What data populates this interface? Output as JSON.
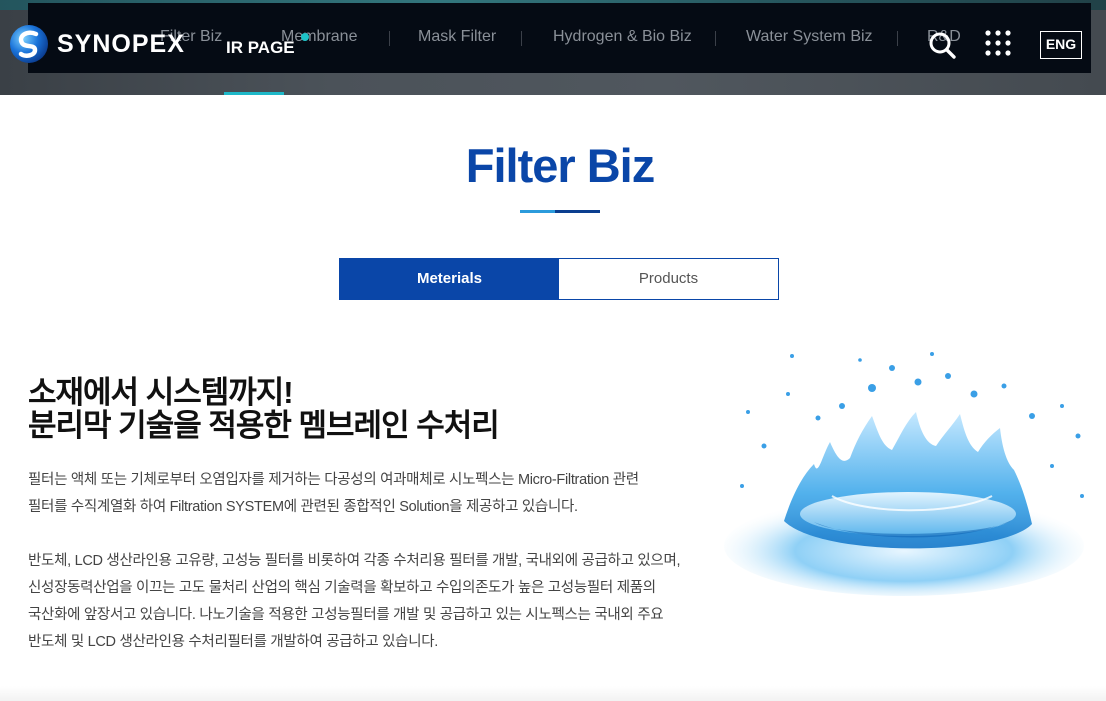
{
  "header": {
    "brand": "SYNOPEX",
    "ir_page": "IR PAGE",
    "nav": [
      "Filter Biz",
      "Membrane",
      "Mask Filter",
      "Hydrogen & Bio Biz",
      "Water System Biz",
      "R&D"
    ],
    "language": "ENG",
    "icons": [
      "synopex-logo-icon",
      "search-icon",
      "grid-menu-icon"
    ]
  },
  "main": {
    "title": "Filter Biz",
    "tabs": [
      {
        "label": "Meterials",
        "active": true
      },
      {
        "label": "Products",
        "active": false
      }
    ],
    "headline": [
      "소재에서 시스템까지!",
      "분리막 기술을 적용한 멤브레인 수처리"
    ],
    "paragraph1": [
      "필터는 액체 또는 기체로부터 오염입자를 제거하는 다공성의 여과매체로 시노펙스는 Micro-Filtration 관련",
      "필터를 수직계열화 하여 Filtration SYSTEM에 관련된 종합적인 Solution을 제공하고 있습니다."
    ],
    "paragraph2": [
      "반도체, LCD 생산라인용 고유량, 고성능 필터를 비롯하여 각종 수처리용 필터를 개발, 국내외에 공급하고 있으며,",
      "신성장동력산업을 이끄는 고도 물처리 산업의 핵심 기술력을 확보하고 수입의존도가 높은 고성능필터 제품의",
      "국산화에 앞장서고 있습니다. 나노기술을 적용한 고성능필터를 개발 및 공급하고 있는 시노펙스는 국내외 주요",
      "반도체 및 LCD 생산라인용 수처리필터를 개발하여 공급하고 있습니다."
    ]
  },
  "colors": {
    "brand_blue": "#0a46a8",
    "accent_teal": "#1eb8c8",
    "navbar_bg": "#050b14"
  }
}
